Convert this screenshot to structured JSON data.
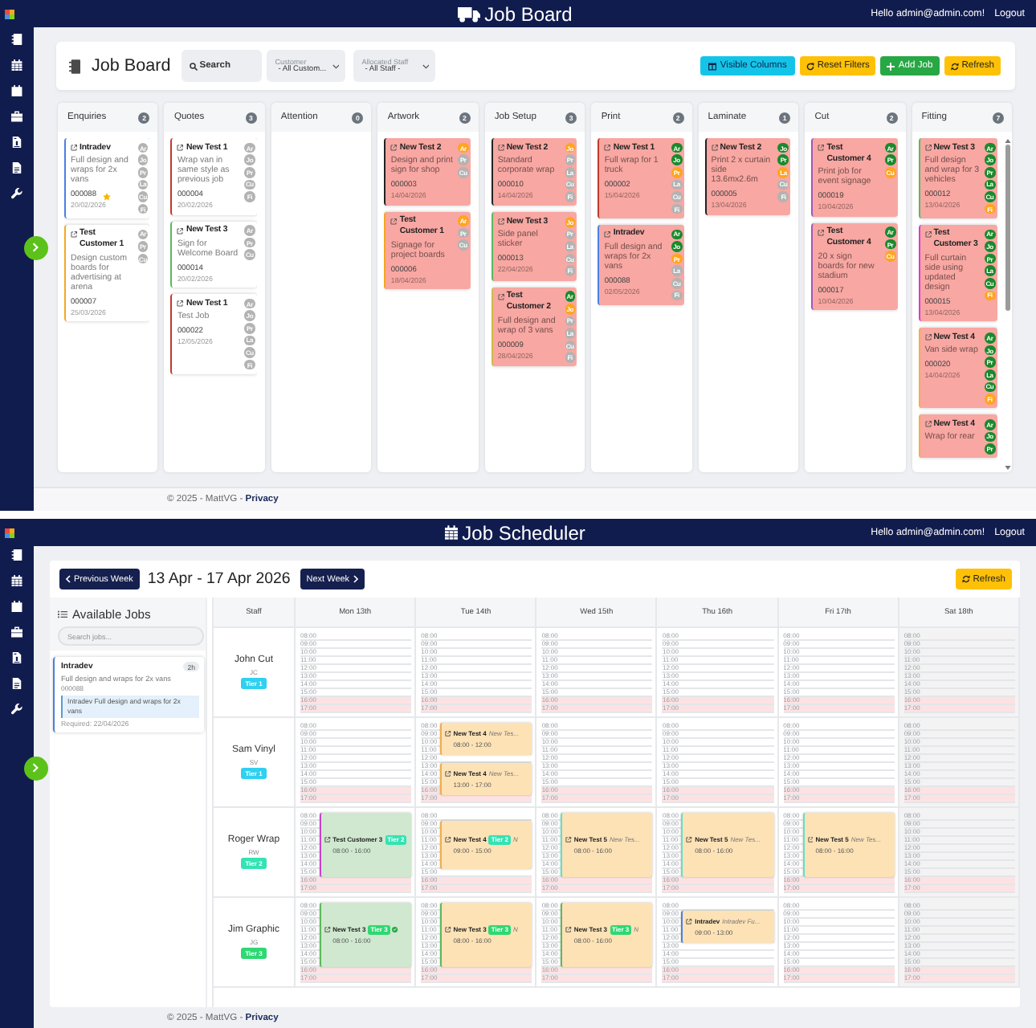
{
  "job_board": {
    "navbar": {
      "title": "Job Board",
      "greeting": "Hello admin@admin.com!",
      "logout": "Logout"
    },
    "header": {
      "title": "Job Board",
      "search": {
        "placeholder": "Search"
      },
      "filters": [
        {
          "label": "Customer",
          "value": "- All Custom..."
        },
        {
          "label": "Allocated Staff",
          "value": "- All Staff -"
        }
      ],
      "buttons": [
        {
          "label": "Visible Columns",
          "kind": "columns"
        },
        {
          "label": "Reset Filters",
          "kind": "reset"
        },
        {
          "label": "Add Job",
          "kind": "add"
        },
        {
          "label": "Refresh",
          "kind": "refresh"
        }
      ]
    },
    "columns": [
      {
        "title": "Enquiries",
        "count": "2",
        "scrollable": false,
        "cards": [
          {
            "title": "Intradev",
            "description": "Full design and wraps for 2x vans",
            "number": "000088",
            "date": "20/02/2026",
            "color": "#4a7fe0",
            "flagged": false,
            "starred": true,
            "stages": [
              {
                "label": "Ar",
                "done": false,
                "active": false
              },
              {
                "label": "Jo",
                "done": false,
                "active": false
              },
              {
                "label": "Pr",
                "done": false,
                "active": false
              },
              {
                "label": "La",
                "done": false,
                "active": false
              },
              {
                "label": "Cu",
                "done": false,
                "active": false
              },
              {
                "label": "Fi",
                "done": false,
                "active": false
              }
            ]
          },
          {
            "title": "Test Customer 1",
            "description": "Design custom boards for advertising at arena",
            "number": "000007",
            "date": "25/03/2026",
            "color": "#f5a623",
            "flagged": false,
            "starred": false,
            "stages": [
              {
                "label": "Ar",
                "done": false,
                "active": false
              },
              {
                "label": "Pr",
                "done": false,
                "active": false
              },
              {
                "label": "Cu",
                "done": false,
                "active": false
              }
            ]
          }
        ]
      },
      {
        "title": "Quotes",
        "count": "3",
        "scrollable": false,
        "cards": [
          {
            "title": "New Test 1",
            "description": "Wrap van in same style as previous job",
            "number": "000004",
            "date": "20/02/2026",
            "color": "#c0392b",
            "flagged": false,
            "starred": false,
            "stages": [
              {
                "label": "Ar",
                "done": false,
                "active": false
              },
              {
                "label": "Jo",
                "done": false,
                "active": false
              },
              {
                "label": "Pr",
                "done": false,
                "active": false
              },
              {
                "label": "Cu",
                "done": false,
                "active": false
              },
              {
                "label": "Fi",
                "done": false,
                "active": false
              }
            ]
          },
          {
            "title": "New Test 3",
            "description": "Sign for Welcome Board",
            "number": "000014",
            "date": "20/02/2026",
            "color": "#5cb85c",
            "flagged": false,
            "starred": false,
            "stages": [
              {
                "label": "Ar",
                "done": false,
                "active": false
              },
              {
                "label": "Pr",
                "done": false,
                "active": false
              },
              {
                "label": "Cu",
                "done": false,
                "active": false
              }
            ]
          },
          {
            "title": "New Test 1",
            "description": "Test Job",
            "number": "000022",
            "date": "12/05/2026",
            "color": "#c0392b",
            "flagged": false,
            "starred": false,
            "stages": [
              {
                "label": "Ar",
                "done": false,
                "active": false
              },
              {
                "label": "Jo",
                "done": false,
                "active": false
              },
              {
                "label": "Pr",
                "done": false,
                "active": false
              },
              {
                "label": "La",
                "done": false,
                "active": false
              },
              {
                "label": "Cu",
                "done": false,
                "active": false
              },
              {
                "label": "Fi",
                "done": false,
                "active": false
              }
            ]
          }
        ]
      },
      {
        "title": "Attention",
        "count": "0",
        "scrollable": false
      },
      {
        "title": "Artwork",
        "count": "2",
        "scrollable": false,
        "cards": [
          {
            "title": "New Test 2",
            "description": "Design and print sign for shop",
            "number": "000003",
            "date": "14/04/2026",
            "color": "#222222",
            "flagged": true,
            "starred": false,
            "stages": [
              {
                "label": "Ar",
                "done": false,
                "active": true
              },
              {
                "label": "Pr",
                "done": false,
                "active": false
              },
              {
                "label": "Cu",
                "done": false,
                "active": false
              }
            ]
          },
          {
            "title": "Test Customer 1",
            "description": "Signage for project boards",
            "number": "000006",
            "date": "18/04/2026",
            "color": "#f5a623",
            "flagged": true,
            "starred": false,
            "stages": [
              {
                "label": "Ar",
                "done": false,
                "active": true
              },
              {
                "label": "Pr",
                "done": false,
                "active": false
              },
              {
                "label": "Cu",
                "done": false,
                "active": false
              }
            ]
          }
        ]
      },
      {
        "title": "Job Setup",
        "count": "3",
        "scrollable": false,
        "cards": [
          {
            "title": "New Test 2",
            "description": "Standard corporate wrap",
            "number": "000010",
            "date": "14/04/2026",
            "color": "#222222",
            "flagged": true,
            "starred": false,
            "stages": [
              {
                "label": "Jo",
                "done": false,
                "active": true
              },
              {
                "label": "Pr",
                "done": false,
                "active": false
              },
              {
                "label": "La",
                "done": false,
                "active": false
              },
              {
                "label": "Cu",
                "done": false,
                "active": false
              },
              {
                "label": "Fi",
                "done": false,
                "active": false
              }
            ]
          },
          {
            "title": "New Test 3",
            "description": "Side panel sticker",
            "number": "000013",
            "date": "22/04/2026",
            "color": "#5cb85c",
            "flagged": true,
            "starred": false,
            "stages": [
              {
                "label": "Jo",
                "done": false,
                "active": true
              },
              {
                "label": "Pr",
                "done": false,
                "active": false
              },
              {
                "label": "La",
                "done": false,
                "active": false
              },
              {
                "label": "Cu",
                "done": false,
                "active": false
              },
              {
                "label": "Fi",
                "done": false,
                "active": false
              }
            ]
          },
          {
            "title": "Test Customer 2",
            "description": "Full design and wrap of 3 vans",
            "number": "000009",
            "date": "28/04/2026",
            "color": "#d4b84a",
            "flagged": true,
            "starred": false,
            "stages": [
              {
                "label": "Ar",
                "done": true,
                "active": false
              },
              {
                "label": "Jo",
                "done": false,
                "active": true
              },
              {
                "label": "Pr",
                "done": false,
                "active": false
              },
              {
                "label": "La",
                "done": false,
                "active": false
              },
              {
                "label": "Cu",
                "done": false,
                "active": false
              },
              {
                "label": "Fi",
                "done": false,
                "active": false
              }
            ]
          }
        ]
      },
      {
        "title": "Print",
        "count": "2",
        "scrollable": false,
        "cards": [
          {
            "title": "New Test 1",
            "description": "Full wrap for 1 truck",
            "number": "000002",
            "date": "15/04/2026",
            "color": "#c0392b",
            "flagged": true,
            "starred": false,
            "stages": [
              {
                "label": "Ar",
                "done": true,
                "active": false
              },
              {
                "label": "Jo",
                "done": true,
                "active": false
              },
              {
                "label": "Pr",
                "done": false,
                "active": true
              },
              {
                "label": "La",
                "done": false,
                "active": false
              },
              {
                "label": "Cu",
                "done": false,
                "active": false
              },
              {
                "label": "Fi",
                "done": false,
                "active": false
              }
            ]
          },
          {
            "title": "Intradev",
            "description": "Full design and wraps for 2x vans",
            "number": "000088",
            "date": "02/05/2026",
            "color": "#4a7fe0",
            "flagged": true,
            "starred": false,
            "stages": [
              {
                "label": "Ar",
                "done": true,
                "active": false
              },
              {
                "label": "Jo",
                "done": true,
                "active": false
              },
              {
                "label": "Pr",
                "done": false,
                "active": true
              },
              {
                "label": "La",
                "done": false,
                "active": false
              },
              {
                "label": "Cu",
                "done": false,
                "active": false
              },
              {
                "label": "Fi",
                "done": false,
                "active": false
              }
            ]
          }
        ]
      },
      {
        "title": "Laminate",
        "count": "1",
        "scrollable": false,
        "cards": [
          {
            "title": "New Test 2",
            "description": "Print 2 x curtain side 13.6mx2.6m",
            "number": "000005",
            "date": "13/04/2026",
            "color": "#222222",
            "flagged": true,
            "starred": false,
            "stages": [
              {
                "label": "Jo",
                "done": true,
                "active": false
              },
              {
                "label": "Pr",
                "done": true,
                "active": false
              },
              {
                "label": "La",
                "done": false,
                "active": true
              },
              {
                "label": "Cu",
                "done": false,
                "active": false
              },
              {
                "label": "Fi",
                "done": false,
                "active": false
              }
            ]
          }
        ]
      },
      {
        "title": "Cut",
        "count": "2",
        "scrollable": false,
        "cards": [
          {
            "title": "Test Customer 4",
            "description": "Print job for event signage",
            "number": "000019",
            "date": "10/04/2026",
            "color": "#9b59b6",
            "flagged": true,
            "starred": false,
            "stages": [
              {
                "label": "Ar",
                "done": true,
                "active": false
              },
              {
                "label": "Pr",
                "done": true,
                "active": false
              },
              {
                "label": "Cu",
                "done": false,
                "active": true
              }
            ]
          },
          {
            "title": "Test Customer 4",
            "description": "20 x sign boards for new stadium",
            "number": "000017",
            "date": "10/04/2026",
            "color": "#9b59b6",
            "flagged": true,
            "starred": false,
            "stages": [
              {
                "label": "Ar",
                "done": true,
                "active": false
              },
              {
                "label": "Pr",
                "done": true,
                "active": false
              },
              {
                "label": "Cu",
                "done": false,
                "active": true
              }
            ]
          }
        ]
      },
      {
        "title": "Fitting",
        "count": "7",
        "scrollable": true,
        "cards": [
          {
            "title": "New Test 3",
            "description": "Full design and wrap for 3 vehicles",
            "number": "000012",
            "date": "13/04/2026",
            "color": "#5cb85c",
            "flagged": true,
            "starred": false,
            "stages": [
              {
                "label": "Ar",
                "done": true,
                "active": false
              },
              {
                "label": "Jo",
                "done": true,
                "active": false
              },
              {
                "label": "Pr",
                "done": true,
                "active": false
              },
              {
                "label": "La",
                "done": true,
                "active": false
              },
              {
                "label": "Cu",
                "done": true,
                "active": false
              },
              {
                "label": "Fi",
                "done": false,
                "active": true
              }
            ]
          },
          {
            "title": "Test Customer 3",
            "description": "Full curtain side using updated design",
            "number": "000015",
            "date": "13/04/2026",
            "color": "#d63ad6",
            "flagged": true,
            "starred": false,
            "stages": [
              {
                "label": "Ar",
                "done": true,
                "active": false
              },
              {
                "label": "Jo",
                "done": true,
                "active": false
              },
              {
                "label": "Pr",
                "done": true,
                "active": false
              },
              {
                "label": "La",
                "done": true,
                "active": false
              },
              {
                "label": "Cu",
                "done": true,
                "active": false
              },
              {
                "label": "Fi",
                "done": false,
                "active": true
              }
            ]
          },
          {
            "title": "New Test 4",
            "description": "Van side wrap",
            "number": "000020",
            "date": "14/04/2026",
            "color": "#f0ad4e",
            "flagged": true,
            "starred": false,
            "stages": [
              {
                "label": "Ar",
                "done": true,
                "active": false
              },
              {
                "label": "Jo",
                "done": true,
                "active": false
              },
              {
                "label": "Pr",
                "done": true,
                "active": false
              },
              {
                "label": "La",
                "done": true,
                "active": false
              },
              {
                "label": "Cu",
                "done": true,
                "active": false
              },
              {
                "label": "Fi",
                "done": false,
                "active": true
              }
            ]
          },
          {
            "title": "New Test 4",
            "description": "Wrap for rear",
            "color": "#f0ad4e",
            "flagged": true,
            "starred": false,
            "stages": [
              {
                "label": "Ar",
                "done": true,
                "active": false
              },
              {
                "label": "Jo",
                "done": true,
                "active": false
              },
              {
                "label": "Pr",
                "done": true,
                "active": false
              }
            ]
          }
        ]
      }
    ],
    "footer": {
      "text": "© 2025 - MattVG -",
      "link": "Privacy"
    }
  },
  "job_scheduler": {
    "navbar": {
      "title": "Job Scheduler",
      "greeting": "Hello admin@admin.com!",
      "logout": "Logout"
    },
    "previous_button": "Previous Week",
    "week_range": "13 Apr - 17 Apr 2026",
    "next_button": "Next Week",
    "refresh_button": "Refresh",
    "available_jobs": {
      "title": "Available Jobs",
      "search_placeholder": "Search jobs...",
      "jobs": [
        {
          "title": "Intradev",
          "duration": "2h",
          "description": "Full design and wraps for 2x vans",
          "number": "000088",
          "note": "Intradev Full design and wraps for 2x vans",
          "required": "Required: 22/04/2026",
          "color": "#4a7fe0"
        }
      ]
    },
    "staff_heading": "Staff",
    "days": [
      {
        "label": "Mon 13th",
        "weekend": false
      },
      {
        "label": "Tue 14th",
        "weekend": false
      },
      {
        "label": "Wed 15th",
        "weekend": false
      },
      {
        "label": "Thu 16th",
        "weekend": false
      },
      {
        "label": "Fri 17th",
        "weekend": false
      },
      {
        "label": "Sat 18th",
        "weekend": true
      }
    ],
    "staff": [
      {
        "name": "John Cut",
        "initials": "JC",
        "tier": {
          "label": "Tier 1",
          "color": "#2fd0f0"
        },
        "cells": [
          {
            "hours": [
              "08:00",
              "09:00",
              "10:00",
              "11:00",
              "12:00",
              "13:00",
              "14:00",
              "15:00"
            ],
            "after_hours": [
              "16:00",
              "17:00"
            ]
          },
          {
            "hours": [
              "08:00",
              "09:00",
              "10:00",
              "11:00",
              "12:00",
              "13:00",
              "14:00",
              "15:00"
            ],
            "after_hours": [
              "16:00",
              "17:00"
            ]
          },
          {
            "hours": [
              "08:00",
              "09:00",
              "10:00",
              "11:00",
              "12:00",
              "13:00",
              "14:00",
              "15:00"
            ],
            "after_hours": [
              "16:00",
              "17:00"
            ]
          },
          {
            "hours": [
              "08:00",
              "09:00",
              "10:00",
              "11:00",
              "12:00",
              "13:00",
              "14:00",
              "15:00"
            ],
            "after_hours": [
              "16:00",
              "17:00"
            ]
          },
          {
            "hours": [
              "08:00",
              "09:00",
              "10:00",
              "11:00",
              "12:00",
              "13:00",
              "14:00",
              "15:00"
            ],
            "after_hours": [
              "16:00",
              "17:00"
            ]
          },
          {
            "hours": [
              "08:00",
              "09:00",
              "10:00",
              "11:00",
              "12:00",
              "13:00",
              "14:00",
              "15:00"
            ],
            "after_hours": [
              "16:00",
              "17:00"
            ]
          }
        ]
      },
      {
        "name": "Sam Vinyl",
        "initials": "SV",
        "tier": {
          "label": "Tier 1",
          "color": "#2fd0f0"
        },
        "cells": [
          {
            "hours": [
              "08:00",
              "09:00",
              "10:00",
              "11:00",
              "12:00",
              "13:00",
              "14:00",
              "15:00"
            ],
            "after_hours": [
              "16:00",
              "17:00"
            ]
          },
          {
            "hours": [
              "08:00",
              "09:00",
              "10:00",
              "11:00",
              "12:00",
              "13:00",
              "14:00",
              "15:00"
            ],
            "after_hours": [
              "16:00",
              "17:00"
            ],
            "jobs": [
              {
                "title": "New Test 4",
                "note": "New Tes...",
                "time": "08:00 - 12:00",
                "color": "#f0ad4e",
                "started": false,
                "confirmed": false
              },
              {
                "title": "New Test 4",
                "note": "New Tes...",
                "time": "13:00 - 17:00",
                "color": "#f0ad4e",
                "started": false,
                "confirmed": false
              }
            ]
          },
          {
            "hours": [
              "08:00",
              "09:00",
              "10:00",
              "11:00",
              "12:00",
              "13:00",
              "14:00",
              "15:00"
            ],
            "after_hours": [
              "16:00",
              "17:00"
            ]
          },
          {
            "hours": [
              "08:00",
              "09:00",
              "10:00",
              "11:00",
              "12:00",
              "13:00",
              "14:00",
              "15:00"
            ],
            "after_hours": [
              "16:00",
              "17:00"
            ]
          },
          {
            "hours": [
              "08:00",
              "09:00",
              "10:00",
              "11:00",
              "12:00",
              "13:00",
              "14:00",
              "15:00"
            ],
            "after_hours": [
              "16:00",
              "17:00"
            ]
          },
          {
            "hours": [
              "08:00",
              "09:00",
              "10:00",
              "11:00",
              "12:00",
              "13:00",
              "14:00",
              "15:00"
            ],
            "after_hours": [
              "16:00",
              "17:00"
            ]
          }
        ]
      },
      {
        "name": "Roger Wrap",
        "initials": "RW",
        "tier": {
          "label": "Tier 2",
          "color": "#33e3b3"
        },
        "cells": [
          {
            "hours": [
              "08:00",
              "09:00",
              "10:00",
              "11:00",
              "12:00",
              "13:00",
              "14:00",
              "15:00"
            ],
            "after_hours": [
              "16:00",
              "17:00"
            ],
            "jobs": [
              {
                "title": "Test Customer 3",
                "tier": {
                  "label": "Tier 2",
                  "color": "#33e3b3"
                },
                "time": "08:00 - 16:00",
                "color": "#c843c8",
                "started": true,
                "confirmed": false
              }
            ]
          },
          {
            "hours": [
              "08:00",
              "09:00",
              "10:00",
              "11:00",
              "12:00",
              "13:00",
              "14:00",
              "15:00"
            ],
            "after_hours": [
              "16:00",
              "17:00"
            ],
            "jobs": [
              {
                "title": "New Test 4",
                "tier": {
                  "label": "Tier 2",
                  "color": "#33e3b3"
                },
                "note": "N",
                "time": "09:00 - 15:00",
                "color": "#f0ad4e",
                "started": false,
                "confirmed": false
              }
            ]
          },
          {
            "hours": [
              "08:00",
              "09:00",
              "10:00",
              "11:00",
              "12:00",
              "13:00",
              "14:00",
              "15:00"
            ],
            "after_hours": [
              "16:00",
              "17:00"
            ],
            "jobs": [
              {
                "title": "New Test 5",
                "note": "New Tes...",
                "time": "08:00 - 16:00",
                "color": "#5fe0c8",
                "started": false,
                "confirmed": false
              }
            ]
          },
          {
            "hours": [
              "08:00",
              "09:00",
              "10:00",
              "11:00",
              "12:00",
              "13:00",
              "14:00",
              "15:00"
            ],
            "after_hours": [
              "16:00",
              "17:00"
            ],
            "jobs": [
              {
                "title": "New Test 5",
                "note": "New Tes...",
                "time": "08:00 - 16:00",
                "color": "#5fe0c8",
                "started": false,
                "confirmed": false
              }
            ]
          },
          {
            "hours": [
              "08:00",
              "09:00",
              "10:00",
              "11:00",
              "12:00",
              "13:00",
              "14:00",
              "15:00"
            ],
            "after_hours": [
              "16:00",
              "17:00"
            ],
            "jobs": [
              {
                "title": "New Test 5",
                "note": "New Tes...",
                "time": "08:00 - 16:00",
                "color": "#5fe0c8",
                "started": false,
                "confirmed": false
              }
            ]
          },
          {
            "hours": [
              "08:00",
              "09:00",
              "10:00",
              "11:00",
              "12:00",
              "13:00",
              "14:00",
              "15:00"
            ],
            "after_hours": [
              "16:00",
              "17:00"
            ]
          }
        ]
      },
      {
        "name": "Jim Graphic",
        "initials": "JG",
        "tier": {
          "label": "Tier 3",
          "color": "#2ed872"
        },
        "cells": [
          {
            "hours": [
              "08:00",
              "09:00",
              "10:00",
              "11:00",
              "12:00",
              "13:00",
              "14:00",
              "15:00"
            ],
            "after_hours": [
              "16:00",
              "17:00"
            ],
            "jobs": [
              {
                "title": "New Test 3",
                "tier": {
                  "label": "Tier 3",
                  "color": "#2ed872"
                },
                "time": "08:00 - 16:00",
                "color": "#5cb85c",
                "started": true,
                "confirmed": true
              }
            ]
          },
          {
            "hours": [
              "08:00",
              "09:00",
              "10:00",
              "11:00",
              "12:00",
              "13:00",
              "14:00",
              "15:00"
            ],
            "after_hours": [
              "16:00",
              "17:00"
            ],
            "jobs": [
              {
                "title": "New Test 3",
                "tier": {
                  "label": "Tier 3",
                  "color": "#2ed872"
                },
                "note": "N",
                "time": "08:00 - 16:00",
                "color": "#5cb85c",
                "started": false,
                "confirmed": false
              }
            ]
          },
          {
            "hours": [
              "08:00",
              "09:00",
              "10:00",
              "11:00",
              "12:00",
              "13:00",
              "14:00",
              "15:00"
            ],
            "after_hours": [
              "16:00",
              "17:00"
            ],
            "jobs": [
              {
                "title": "New Test 3",
                "tier": {
                  "label": "Tier 3",
                  "color": "#2ed872"
                },
                "note": "N",
                "time": "08:00 - 16:00",
                "color": "#5cb85c",
                "started": false,
                "confirmed": false
              }
            ]
          },
          {
            "hours": [
              "08:00",
              "09:00",
              "10:00",
              "11:00",
              "12:00",
              "13:00",
              "14:00",
              "15:00"
            ],
            "after_hours": [
              "16:00",
              "17:00"
            ],
            "jobs": [
              {
                "title": "Intradev",
                "note": "Intradev Fu...",
                "time": "09:00 - 13:00",
                "color": "#4a7fe0",
                "started": false,
                "confirmed": false
              }
            ]
          },
          {
            "hours": [
              "08:00",
              "09:00",
              "10:00",
              "11:00",
              "12:00",
              "13:00",
              "14:00",
              "15:00"
            ],
            "after_hours": [
              "16:00",
              "17:00"
            ]
          },
          {
            "hours": [
              "08:00",
              "09:00",
              "10:00",
              "11:00",
              "12:00",
              "13:00",
              "14:00",
              "15:00"
            ],
            "after_hours": [
              "16:00",
              "17:00"
            ]
          }
        ]
      }
    ],
    "footer": {
      "text": "© 2025 - MattVG -",
      "link": "Privacy"
    }
  }
}
